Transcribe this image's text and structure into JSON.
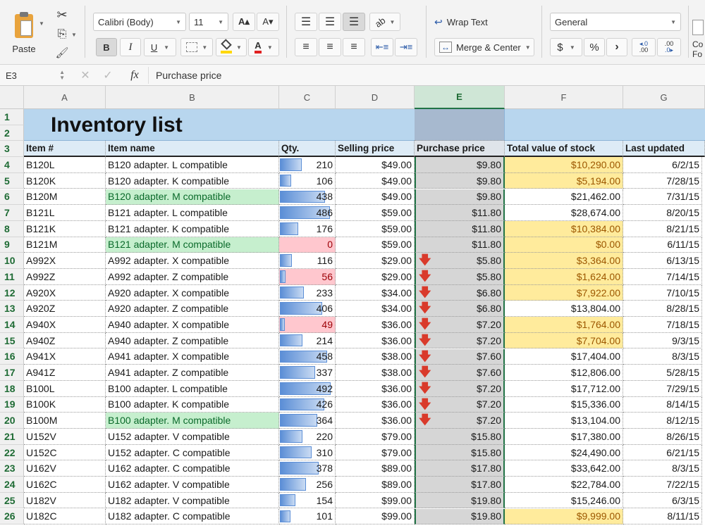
{
  "ribbon": {
    "paste_label": "Paste",
    "font_name": "Calibri (Body)",
    "font_size": "11",
    "increase_font": "A▴",
    "decrease_font": "A▾",
    "bold": "B",
    "italic": "I",
    "underline": "U",
    "wrap_text": "Wrap Text",
    "merge_center": "Merge & Center",
    "number_format": "General",
    "currency": "$",
    "percent": "%",
    "comma": "›",
    "increase_decimal": ".00",
    "decrease_decimal": ".00",
    "cond_format_partial_1": "Co",
    "cond_format_partial_2": "Fo",
    "fill_color": "#ffd800",
    "font_color": "#e02020"
  },
  "formula_bar": {
    "cell_ref": "E3",
    "fx_label": "fx",
    "content": "Purchase price"
  },
  "sheet": {
    "columns": [
      "A",
      "B",
      "C",
      "D",
      "E",
      "F",
      "G"
    ],
    "selected_column": "E",
    "title": "Inventory list",
    "headers": [
      "Item #",
      "Item name",
      "Qty.",
      "Selling price",
      "Purchase price",
      "Total value of stock",
      "Last updated"
    ],
    "row_numbers": [
      "1",
      "2",
      "3",
      "4",
      "5",
      "6",
      "7",
      "8",
      "9",
      "10",
      "11",
      "12",
      "13",
      "14",
      "15",
      "16",
      "17",
      "18",
      "19",
      "20",
      "21",
      "22",
      "23",
      "24",
      "25",
      "26"
    ],
    "rows": [
      {
        "item": "B120L",
        "name": "B120 adapter. L compatible",
        "qty": "210",
        "qty_fill": 0.43,
        "price": "$49.00",
        "purchase": "$9.80",
        "arrow": false,
        "total": "$10,290.00",
        "total_hl": true,
        "updated": "6/2/15"
      },
      {
        "item": "B120K",
        "name": "B120 adapter. K compatible",
        "qty": "106",
        "qty_fill": 0.22,
        "price": "$49.00",
        "purchase": "$9.80",
        "arrow": false,
        "total": "$5,194.00",
        "total_hl": true,
        "updated": "7/28/15"
      },
      {
        "item": "B120M",
        "name": "B120 adapter. M compatible",
        "name_hl": "green",
        "qty": "438",
        "qty_fill": 0.89,
        "price": "$49.00",
        "purchase": "$9.80",
        "arrow": false,
        "total": "$21,462.00",
        "total_hl": false,
        "updated": "7/31/15"
      },
      {
        "item": "B121L",
        "name": "B121 adapter. L compatible",
        "qty": "486",
        "qty_fill": 0.99,
        "price": "$59.00",
        "purchase": "$11.80",
        "arrow": false,
        "total": "$28,674.00",
        "total_hl": false,
        "updated": "8/20/15"
      },
      {
        "item": "B121K",
        "name": "B121 adapter. K compatible",
        "qty": "176",
        "qty_fill": 0.36,
        "price": "$59.00",
        "purchase": "$11.80",
        "arrow": false,
        "total": "$10,384.00",
        "total_hl": true,
        "updated": "8/21/15"
      },
      {
        "item": "B121M",
        "name": "B121 adapter. M compatible",
        "name_hl": "green",
        "qty": "0",
        "qty_fill": 0,
        "qty_hl": true,
        "price": "$59.00",
        "purchase": "$11.80",
        "arrow": false,
        "total": "$0.00",
        "total_hl": true,
        "updated": "6/11/15"
      },
      {
        "item": "A992X",
        "name": "A992 adapter. X compatible",
        "qty": "116",
        "qty_fill": 0.24,
        "price": "$29.00",
        "purchase": "$5.80",
        "arrow": true,
        "total": "$3,364.00",
        "total_hl": true,
        "updated": "6/13/15"
      },
      {
        "item": "A992Z",
        "name": "A992 adapter. Z compatible",
        "qty": "56",
        "qty_fill": 0.11,
        "qty_hl": true,
        "price": "$29.00",
        "purchase": "$5.80",
        "arrow": true,
        "total": "$1,624.00",
        "total_hl": true,
        "updated": "7/14/15"
      },
      {
        "item": "A920X",
        "name": "A920 adapter. X compatible",
        "qty": "233",
        "qty_fill": 0.47,
        "price": "$34.00",
        "purchase": "$6.80",
        "arrow": true,
        "total": "$7,922.00",
        "total_hl": true,
        "updated": "7/10/15"
      },
      {
        "item": "A920Z",
        "name": "A920 adapter. Z compatible",
        "qty": "406",
        "qty_fill": 0.83,
        "price": "$34.00",
        "purchase": "$6.80",
        "arrow": true,
        "total": "$13,804.00",
        "total_hl": false,
        "updated": "8/28/15"
      },
      {
        "item": "A940X",
        "name": "A940 adapter. X compatible",
        "qty": "49",
        "qty_fill": 0.1,
        "qty_hl": true,
        "price": "$36.00",
        "purchase": "$7.20",
        "arrow": true,
        "total": "$1,764.00",
        "total_hl": true,
        "updated": "7/18/15"
      },
      {
        "item": "A940Z",
        "name": "A940 adapter. Z compatible",
        "qty": "214",
        "qty_fill": 0.44,
        "price": "$36.00",
        "purchase": "$7.20",
        "arrow": true,
        "total": "$7,704.00",
        "total_hl": true,
        "updated": "9/3/15"
      },
      {
        "item": "A941X",
        "name": "A941 adapter. X compatible",
        "qty": "458",
        "qty_fill": 0.93,
        "price": "$38.00",
        "purchase": "$7.60",
        "arrow": true,
        "total": "$17,404.00",
        "total_hl": false,
        "updated": "8/3/15"
      },
      {
        "item": "A941Z",
        "name": "A941 adapter. Z compatible",
        "qty": "337",
        "qty_fill": 0.69,
        "price": "$38.00",
        "purchase": "$7.60",
        "arrow": true,
        "total": "$12,806.00",
        "total_hl": false,
        "updated": "5/28/15"
      },
      {
        "item": "B100L",
        "name": "B100 adapter. L compatible",
        "qty": "492",
        "qty_fill": 1.0,
        "price": "$36.00",
        "purchase": "$7.20",
        "arrow": true,
        "total": "$17,712.00",
        "total_hl": false,
        "updated": "7/29/15"
      },
      {
        "item": "B100K",
        "name": "B100 adapter. K compatible",
        "qty": "426",
        "qty_fill": 0.87,
        "price": "$36.00",
        "purchase": "$7.20",
        "arrow": true,
        "total": "$15,336.00",
        "total_hl": false,
        "updated": "8/14/15"
      },
      {
        "item": "B100M",
        "name": "B100 adapter. M compatible",
        "name_hl": "green",
        "qty": "364",
        "qty_fill": 0.74,
        "price": "$36.00",
        "purchase": "$7.20",
        "arrow": true,
        "total": "$13,104.00",
        "total_hl": false,
        "updated": "8/12/15"
      },
      {
        "item": "U152V",
        "name": "U152 adapter. V compatible",
        "qty": "220",
        "qty_fill": 0.45,
        "price": "$79.00",
        "purchase": "$15.80",
        "arrow": false,
        "total": "$17,380.00",
        "total_hl": false,
        "updated": "8/26/15"
      },
      {
        "item": "U152C",
        "name": "U152 adapter. C compatible",
        "qty": "310",
        "qty_fill": 0.63,
        "price": "$79.00",
        "purchase": "$15.80",
        "arrow": false,
        "total": "$24,490.00",
        "total_hl": false,
        "updated": "6/21/15"
      },
      {
        "item": "U162V",
        "name": "U162 adapter. C compatible",
        "qty": "378",
        "qty_fill": 0.77,
        "price": "$89.00",
        "purchase": "$17.80",
        "arrow": false,
        "total": "$33,642.00",
        "total_hl": false,
        "updated": "8/3/15"
      },
      {
        "item": "U162C",
        "name": "U162 adapter. V compatible",
        "qty": "256",
        "qty_fill": 0.52,
        "price": "$89.00",
        "purchase": "$17.80",
        "arrow": false,
        "total": "$22,784.00",
        "total_hl": false,
        "updated": "7/22/15"
      },
      {
        "item": "U182V",
        "name": "U182 adapter. V compatible",
        "qty": "154",
        "qty_fill": 0.31,
        "price": "$99.00",
        "purchase": "$19.80",
        "arrow": false,
        "total": "$15,246.00",
        "total_hl": false,
        "updated": "6/3/15"
      },
      {
        "item": "U182C",
        "name": "U182 adapter. C compatible",
        "qty": "101",
        "qty_fill": 0.21,
        "price": "$99.00",
        "purchase": "$19.80",
        "arrow": false,
        "total": "$9,999.00",
        "total_hl": true,
        "updated": "8/11/15"
      }
    ]
  }
}
